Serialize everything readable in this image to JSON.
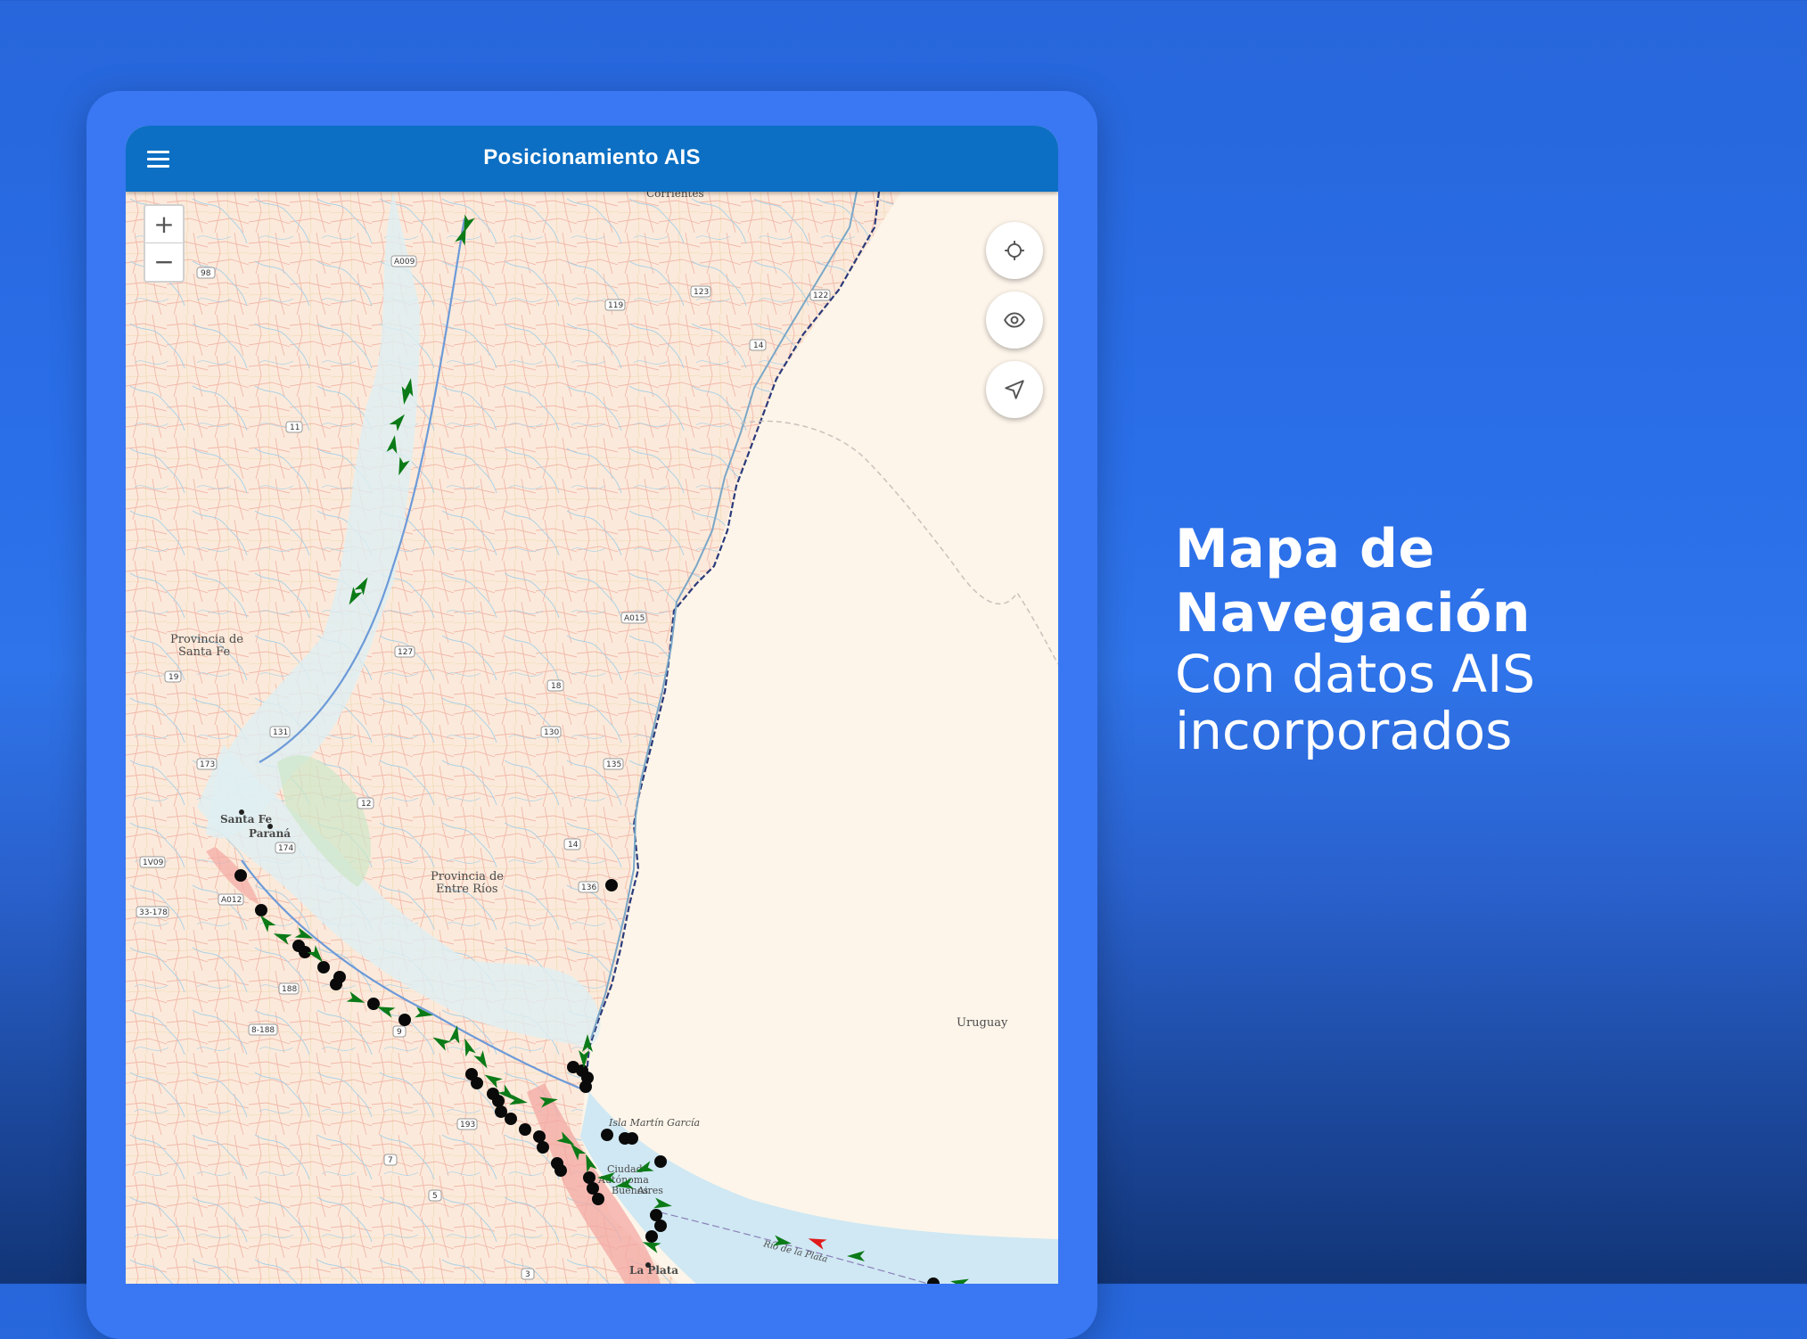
{
  "app": {
    "title": "Posicionamiento AIS",
    "menu_icon": "menu-icon"
  },
  "map_controls": {
    "zoom_in": "+",
    "zoom_out": "−",
    "buttons": [
      "crosshair-icon",
      "eye-icon",
      "navigation-arrow-icon"
    ]
  },
  "map_labels": {
    "country_uruguay": "Uruguay",
    "province_santa_fe": [
      "Provincia de",
      "Santa Fe"
    ],
    "province_entre_rios": [
      "Provincia de",
      "Entre Ríos"
    ],
    "city_santa_fe": "Santa Fe",
    "city_parana": "Paraná",
    "city_la_plata": "La Plata",
    "city_buenos_aires": [
      "Ciudad",
      "Autónoma",
      "Buenos",
      "Aires"
    ],
    "isla_martin_garcia": "Isla Martín García",
    "rio_de_la_plata": "Río de la Plata",
    "corrientes": "Corrientes",
    "route_98": "98",
    "route_a009": "A009",
    "route_119": "119",
    "route_123": "123",
    "route_122": "122",
    "route_14a": "14",
    "route_11": "11",
    "route_a015": "A015",
    "route_127": "127",
    "route_19": "19",
    "route_18": "18",
    "route_131": "131",
    "route_130": "130",
    "route_173": "173",
    "route_135": "135",
    "route_12": "12",
    "route_174": "174",
    "route_14b": "14",
    "route_1v09": "1V09",
    "route_136": "136",
    "route_a012": "A012",
    "route_33178": "33-178",
    "route_188": "188",
    "route_8188": "8-188",
    "route_193": "193",
    "route_7": "7",
    "route_9": "9",
    "route_5": "5",
    "route_3": "3"
  },
  "colors": {
    "app_bar": "#0c6fc3",
    "vessel_moving": "#0b7a17",
    "vessel_moving_alert": "#e01b1b",
    "vessel_anchored": "#0a0a0a",
    "water": "#cfe8f3",
    "land": "#fdf5ea"
  },
  "headline": {
    "title": "Mapa de Navegación",
    "line1": "Con datos AIS",
    "line2": "incorporados"
  }
}
